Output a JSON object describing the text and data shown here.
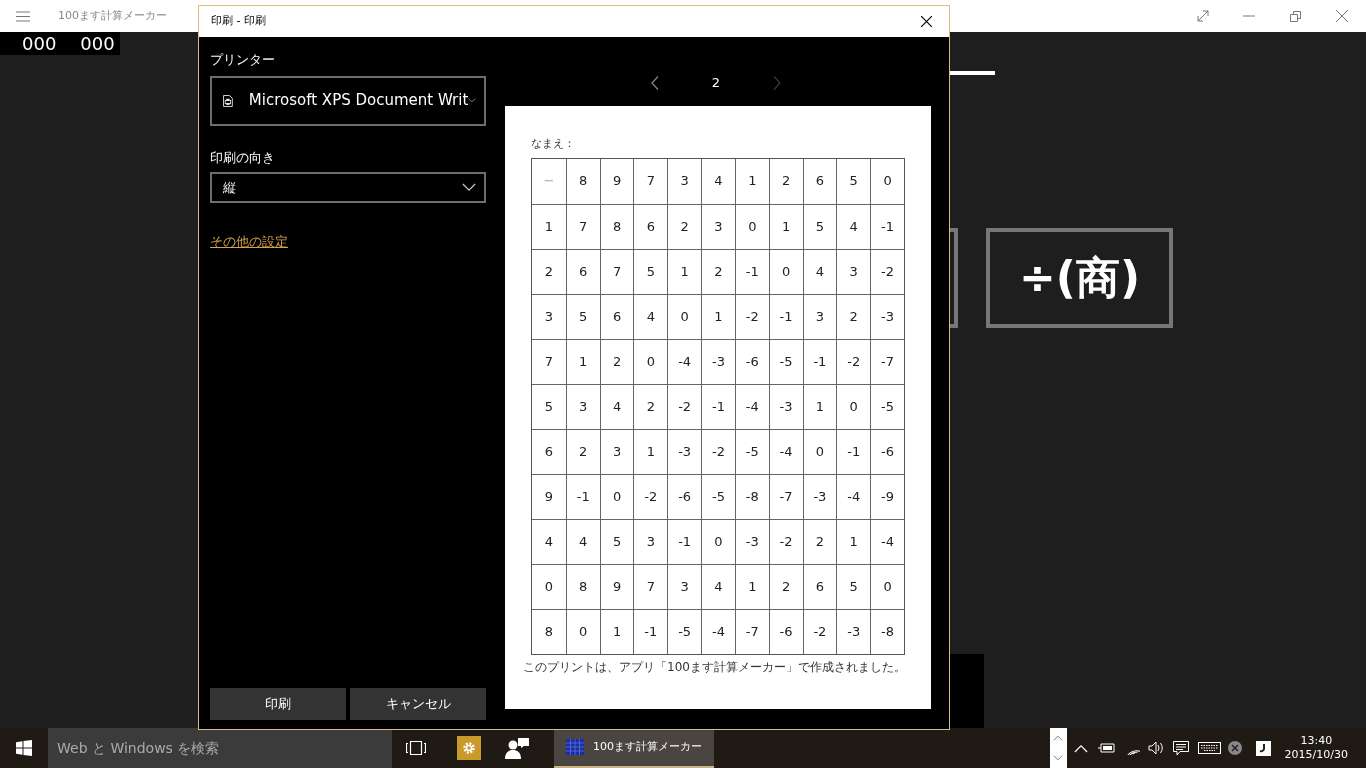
{
  "app": {
    "title": "100ます計算メーカー",
    "scores": [
      "000",
      "000"
    ],
    "operation_buttons": [
      {
        "label": "÷(商)"
      }
    ]
  },
  "dialog": {
    "title": "印刷 - 印刷",
    "printer": {
      "label": "プリンター",
      "value": "Microsoft XPS Document Writ"
    },
    "orientation": {
      "label": "印刷の向き",
      "value": "縦"
    },
    "more_settings_link": "その他の設定",
    "buttons": [
      "印刷",
      "キャンセル"
    ],
    "pager": {
      "page": "2",
      "prev_disabled": false,
      "next_disabled": true
    },
    "preview": {
      "name_label": "なまえ：",
      "rows": [
        [
          "−",
          "8",
          "9",
          "7",
          "3",
          "4",
          "1",
          "2",
          "6",
          "5",
          "0"
        ],
        [
          "1",
          "7",
          "8",
          "6",
          "2",
          "3",
          "0",
          "1",
          "5",
          "4",
          "-1"
        ],
        [
          "2",
          "6",
          "7",
          "5",
          "1",
          "2",
          "-1",
          "0",
          "4",
          "3",
          "-2"
        ],
        [
          "3",
          "5",
          "6",
          "4",
          "0",
          "1",
          "-2",
          "-1",
          "3",
          "2",
          "-3"
        ],
        [
          "7",
          "1",
          "2",
          "0",
          "-4",
          "-3",
          "-6",
          "-5",
          "-1",
          "-2",
          "-7"
        ],
        [
          "5",
          "3",
          "4",
          "2",
          "-2",
          "-1",
          "-4",
          "-3",
          "1",
          "0",
          "-5"
        ],
        [
          "6",
          "2",
          "3",
          "1",
          "-3",
          "-2",
          "-5",
          "-4",
          "0",
          "-1",
          "-6"
        ],
        [
          "9",
          "-1",
          "0",
          "-2",
          "-6",
          "-5",
          "-8",
          "-7",
          "-3",
          "-4",
          "-9"
        ],
        [
          "4",
          "4",
          "5",
          "3",
          "-1",
          "0",
          "-3",
          "-2",
          "2",
          "1",
          "-4"
        ],
        [
          "0",
          "8",
          "9",
          "7",
          "3",
          "4",
          "1",
          "2",
          "6",
          "5",
          "0"
        ],
        [
          "8",
          "0",
          "1",
          "-1",
          "-5",
          "-4",
          "-7",
          "-6",
          "-2",
          "-3",
          "-8"
        ]
      ],
      "footer": "このプリントは、アプリ「100ます計算メーカー」で作成されました。"
    }
  },
  "taskbar": {
    "search_placeholder": "Web と Windows を検索",
    "active_app": "100ます計算メーカー",
    "time": "13:40",
    "date": "2015/10/30"
  }
}
